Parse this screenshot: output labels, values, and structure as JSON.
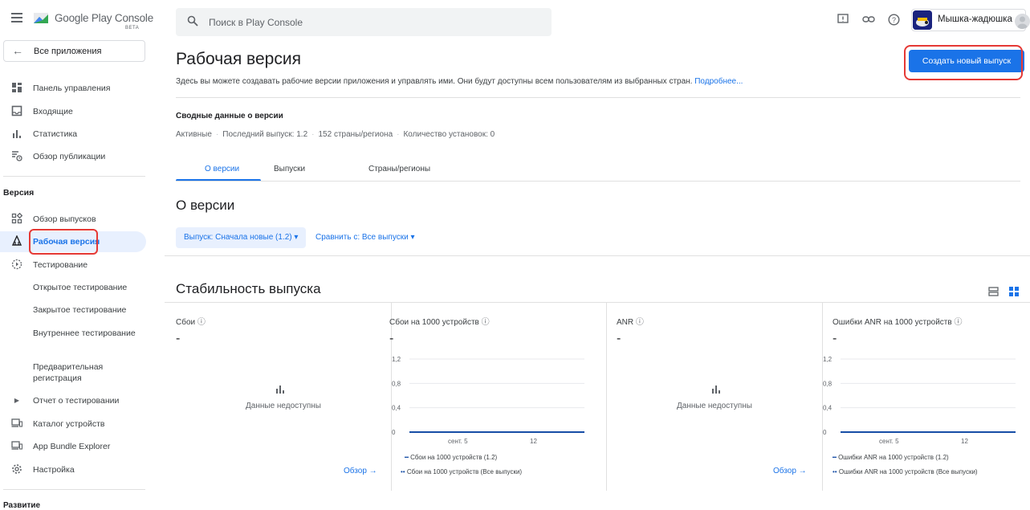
{
  "brand": {
    "name": "Google Play Console",
    "badge": "BETA"
  },
  "sidebar": {
    "all_apps": "Все приложения",
    "main_items": [
      {
        "label": "Панель управления"
      },
      {
        "label": "Входящие"
      },
      {
        "label": "Статистика"
      },
      {
        "label": "Обзор публикации"
      }
    ],
    "section_release": "Версия",
    "release_items": [
      {
        "label": "Обзор выпусков"
      },
      {
        "label": "Рабочая версия"
      },
      {
        "label": "Тестирование"
      },
      {
        "label": "Открытое тестирование"
      },
      {
        "label": "Закрытое тестирование"
      },
      {
        "label": "Внутреннее тестирование"
      },
      {
        "label": "Предварительная регистрация"
      },
      {
        "label": "Отчет о тестировании"
      },
      {
        "label": "Каталог устройств"
      },
      {
        "label": "App Bundle Explorer"
      },
      {
        "label": "Настройка"
      }
    ],
    "section_growth": "Развитие"
  },
  "search": {
    "placeholder": "Поиск в Play Console"
  },
  "developer": {
    "name": "Мышка-жадюшка"
  },
  "page": {
    "title": "Рабочая версия",
    "description": "Здесь вы можете создавать рабочие версии приложения и управлять ими. Они будут доступны всем пользователям из выбранных стран.",
    "learn_more": "Подробнее...",
    "create_button": "Создать новый выпуск"
  },
  "summary": {
    "title": "Сводные данные о версии",
    "status": "Активные",
    "last_release": "Последний выпуск: 1.2",
    "countries": "152 страны/региона",
    "installs": "Количество установок: 0"
  },
  "tabs": [
    {
      "label": "О версии"
    },
    {
      "label": "Выпуски"
    },
    {
      "label": "Страны/регионы"
    }
  ],
  "about": {
    "title": "О версии",
    "filter_release": "Выпуск: Сначала новые (1.2)",
    "filter_compare": "Сравнить с: Все выпуски"
  },
  "stability": {
    "title": "Стабильность выпуска",
    "no_data": "Данные недоступны",
    "overview_link": "Обзор",
    "cards": [
      {
        "title": "Сбои",
        "value": "-"
      },
      {
        "title": "Сбои на 1000 устройств",
        "value": "-",
        "y_ticks": [
          "1,2",
          "0,8",
          "0,4",
          "0"
        ],
        "x_ticks": [
          "сент. 5",
          "12"
        ],
        "legend": [
          "Сбои на 1000 устройств (1.2)",
          "Сбои на 1000 устройств (Все выпуски)"
        ]
      },
      {
        "title": "ANR",
        "value": "-"
      },
      {
        "title": "Ошибки ANR на 1000 устройств",
        "value": "-",
        "y_ticks": [
          "1,2",
          "0,8",
          "0,4",
          "0"
        ],
        "x_ticks": [
          "сент. 5",
          "12"
        ],
        "legend": [
          "Ошибки ANR на 1000 устройств (1.2)",
          "Ошибки ANR на 1000 устройств (Все выпуски)"
        ]
      }
    ]
  },
  "colors": {
    "accent": "#1a73e8",
    "highlight": "#e53935",
    "series": "#174ea6"
  }
}
